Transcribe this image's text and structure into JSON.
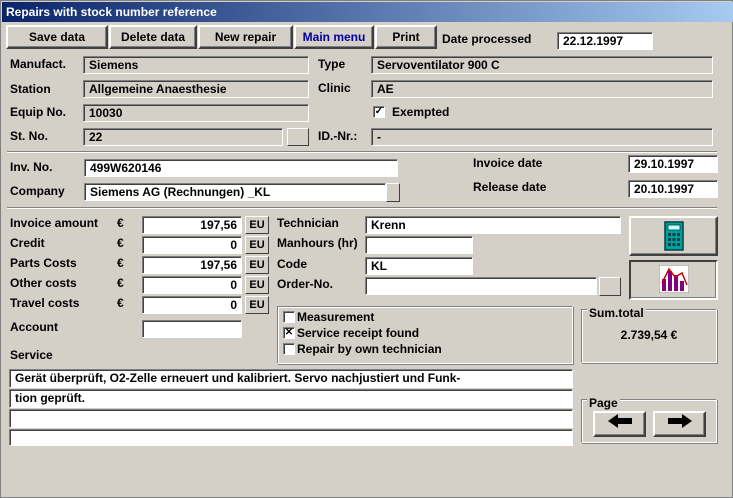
{
  "window": {
    "title": "Repairs with stock number reference"
  },
  "toolbar": {
    "save": "Save data",
    "delete": "Delete data",
    "new": "New repair",
    "main": "Main menu",
    "print": "Print",
    "date_label": "Date processed",
    "date_value": "22.12.1997"
  },
  "device": {
    "manufact_label": "Manufact.",
    "manufact": "Siemens",
    "station_label": "Station",
    "station": "Allgemeine Anaesthesie",
    "equip_label": "Equip No.",
    "equip": "10030",
    "stno_label": "St. No.",
    "stno": "22",
    "type_label": "Type",
    "type": "Servoventilator 900 C",
    "clinic_label": "Clinic",
    "clinic": "AE",
    "exempted_label": "Exempted",
    "exempted_checked": "✓",
    "idnr_label": "ID.-Nr.:",
    "idnr": "-"
  },
  "invoice": {
    "inv_label": "Inv. No.",
    "inv": "499W620146",
    "company_label": "Company",
    "company": "Siemens AG (Rechnungen) _KL",
    "invdate_label": "Invoice date",
    "invdate": "29.10.1997",
    "reldate_label": "Release date",
    "reldate": "20.10.1997"
  },
  "costs": {
    "currency": "€",
    "eu": "EU",
    "rows": [
      {
        "label": "Invoice amount",
        "value": "197,56"
      },
      {
        "label": "Credit",
        "value": "0"
      },
      {
        "label": "Parts Costs",
        "value": "197,56"
      },
      {
        "label": "Other costs",
        "value": "0"
      },
      {
        "label": "Travel costs",
        "value": "0"
      }
    ],
    "account_label": "Account",
    "account": ""
  },
  "tech": {
    "technician_label": "Technician",
    "technician": "Krenn",
    "manhours_label": "Manhours (hr)",
    "manhours": "",
    "code_label": "Code",
    "code": "KL",
    "order_label": "Order-No.",
    "order": ""
  },
  "flags": {
    "measurement": "Measurement",
    "measurement_mark": "",
    "receipt": "Service receipt found",
    "receipt_mark": "✕",
    "own": "Repair by own technician",
    "own_mark": ""
  },
  "sum": {
    "label": "Sum.total",
    "value": "2.739,54 €"
  },
  "service": {
    "label": "Service",
    "lines": [
      "Gerät überprüft, O2-Zelle erneuert und kalibriert. Servo nachjustiert und Funk-",
      "tion geprüft.",
      "",
      ""
    ]
  },
  "page": {
    "label": "Page"
  }
}
